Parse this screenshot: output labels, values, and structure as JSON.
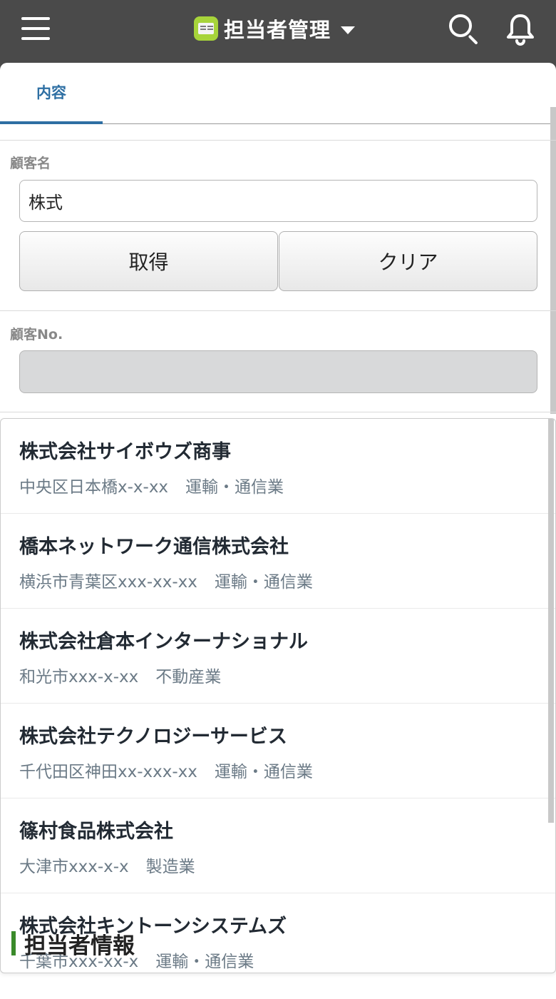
{
  "header": {
    "app_title": "担当者管理",
    "icons": {
      "menu": "hamburger-icon",
      "search": "search-icon",
      "notifications": "bell-icon",
      "app": "contact-card-icon",
      "caret": "caret-down-icon"
    }
  },
  "tabs": [
    {
      "label": "内容",
      "active": true
    }
  ],
  "form": {
    "customer_name_label": "顧客名",
    "customer_name_value": "株式",
    "get_button": "取得",
    "clear_button": "クリア",
    "customer_no_label": "顧客No.",
    "customer_no_value": ""
  },
  "results": [
    {
      "name": "株式会社サイボウズ商事",
      "address": "中央区日本橋x-x-xx",
      "industry": "運輸・通信業"
    },
    {
      "name": "橋本ネットワーク通信株式会社",
      "address": "横浜市青葉区xxx-xx-xx",
      "industry": "運輸・通信業"
    },
    {
      "name": "株式会社倉本インターナショナル",
      "address": "和光市xxx-x-xx",
      "industry": "不動産業"
    },
    {
      "name": "株式会社テクノロジーサービス",
      "address": "千代田区神田xx-xxx-xx",
      "industry": "運輸・通信業"
    },
    {
      "name": "篠村食品株式会社",
      "address": "大津市xxx-x-x",
      "industry": "製造業"
    },
    {
      "name": "株式会社キントーンシステムズ",
      "address": "千葉市xxx-xx-x",
      "industry": "運輸・通信業"
    }
  ],
  "section": {
    "title": "担当者情報"
  },
  "colors": {
    "header_bg": "#4a4a4a",
    "tab_accent": "#2e6fa3",
    "app_icon": "#a7d43a",
    "section_bar": "#3a8a2a"
  }
}
